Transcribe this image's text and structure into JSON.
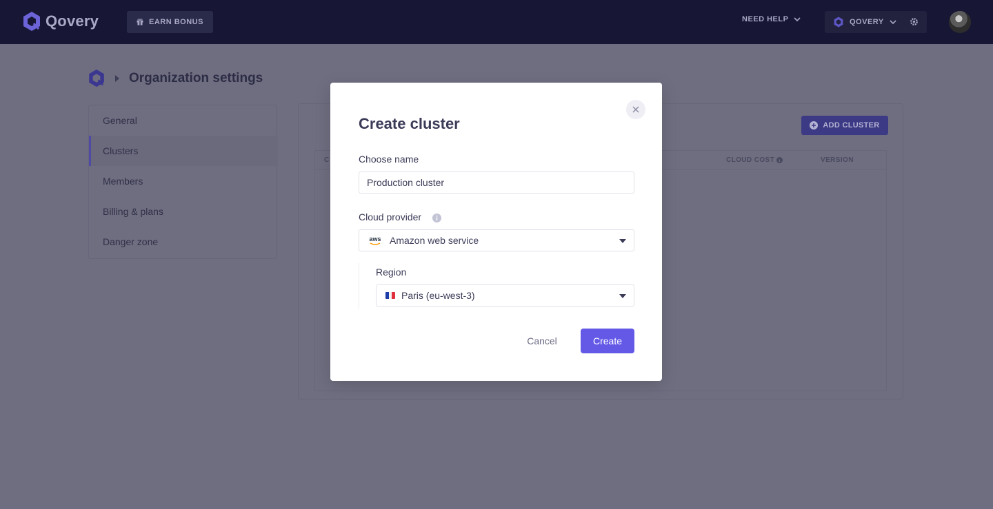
{
  "topbar": {
    "brand": "Qovery",
    "earn_bonus": "EARN BONUS",
    "need_help": "NEED HELP",
    "org_name": "QOVERY"
  },
  "breadcrumb": {
    "title": "Organization settings"
  },
  "sidebar": {
    "items": [
      {
        "label": "General"
      },
      {
        "label": "Clusters"
      },
      {
        "label": "Members"
      },
      {
        "label": "Billing & plans"
      },
      {
        "label": "Danger zone"
      }
    ]
  },
  "clusters_panel": {
    "add_button": "ADD CLUSTER",
    "columns": [
      "C",
      "CLOUD COST",
      "VERSION"
    ]
  },
  "modal": {
    "title": "Create cluster",
    "name_label": "Choose name",
    "name_value": "Production cluster",
    "provider_label": "Cloud provider",
    "provider_value": "Amazon web service",
    "provider_logo_text": "aws",
    "region_label": "Region",
    "region_value": "Paris (eu-west-3)",
    "cancel": "Cancel",
    "create": "Create"
  },
  "colors": {
    "topbar": "#171735",
    "overlay": "#6f6e80",
    "accent": "#6459e6",
    "aws_orange": "#ff9900"
  },
  "icons": [
    "qovery-logo",
    "gift-icon",
    "chevron-down-icon",
    "gear-icon",
    "breadcrumb-arrow-icon",
    "plus-circle-icon",
    "info-icon",
    "close-icon",
    "caret-down-icon",
    "aws-logo",
    "france-flag-icon"
  ]
}
